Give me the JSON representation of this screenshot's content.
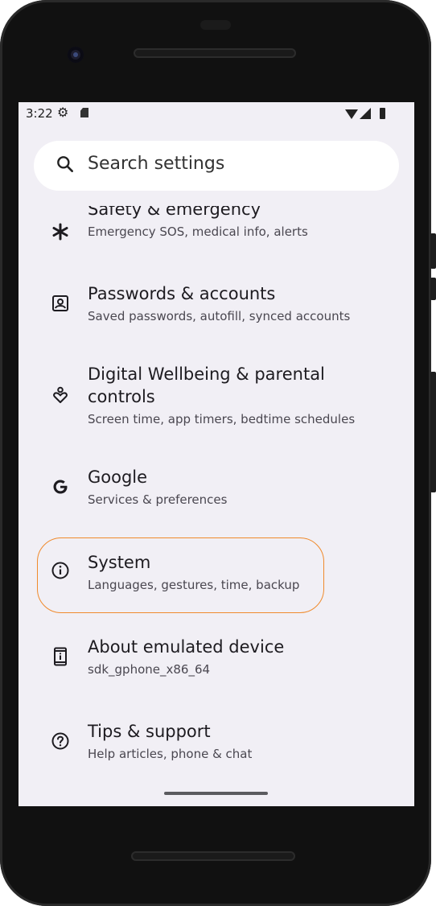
{
  "status_bar": {
    "time": "3:22"
  },
  "search": {
    "placeholder": "Search settings"
  },
  "items": [
    {
      "title": "Safety & emergency",
      "subtitle": "Emergency SOS, medical info, alerts",
      "icon": "asterisk-icon"
    },
    {
      "title": "Passwords & accounts",
      "subtitle": "Saved passwords, autofill, synced accounts",
      "icon": "account-box-icon"
    },
    {
      "title": "Digital Wellbeing & parental controls",
      "title_line1": "Digital Wellbeing & parental",
      "title_line2": "controls",
      "subtitle": "Screen time, app timers, bedtime schedules",
      "icon": "wellbeing-icon"
    },
    {
      "title": "Google",
      "subtitle": "Services & preferences",
      "icon": "google-icon"
    },
    {
      "title": "System",
      "subtitle": "Languages, gestures, time, backup",
      "icon": "info-icon"
    },
    {
      "title": "About emulated device",
      "subtitle": "sdk_gphone_x86_64",
      "icon": "phone-info-icon"
    },
    {
      "title": "Tips & support",
      "subtitle": "Help articles, phone & chat",
      "icon": "help-icon"
    }
  ],
  "colors": {
    "screen_bg": "#f1eff5",
    "highlight": "#f08a2c"
  }
}
